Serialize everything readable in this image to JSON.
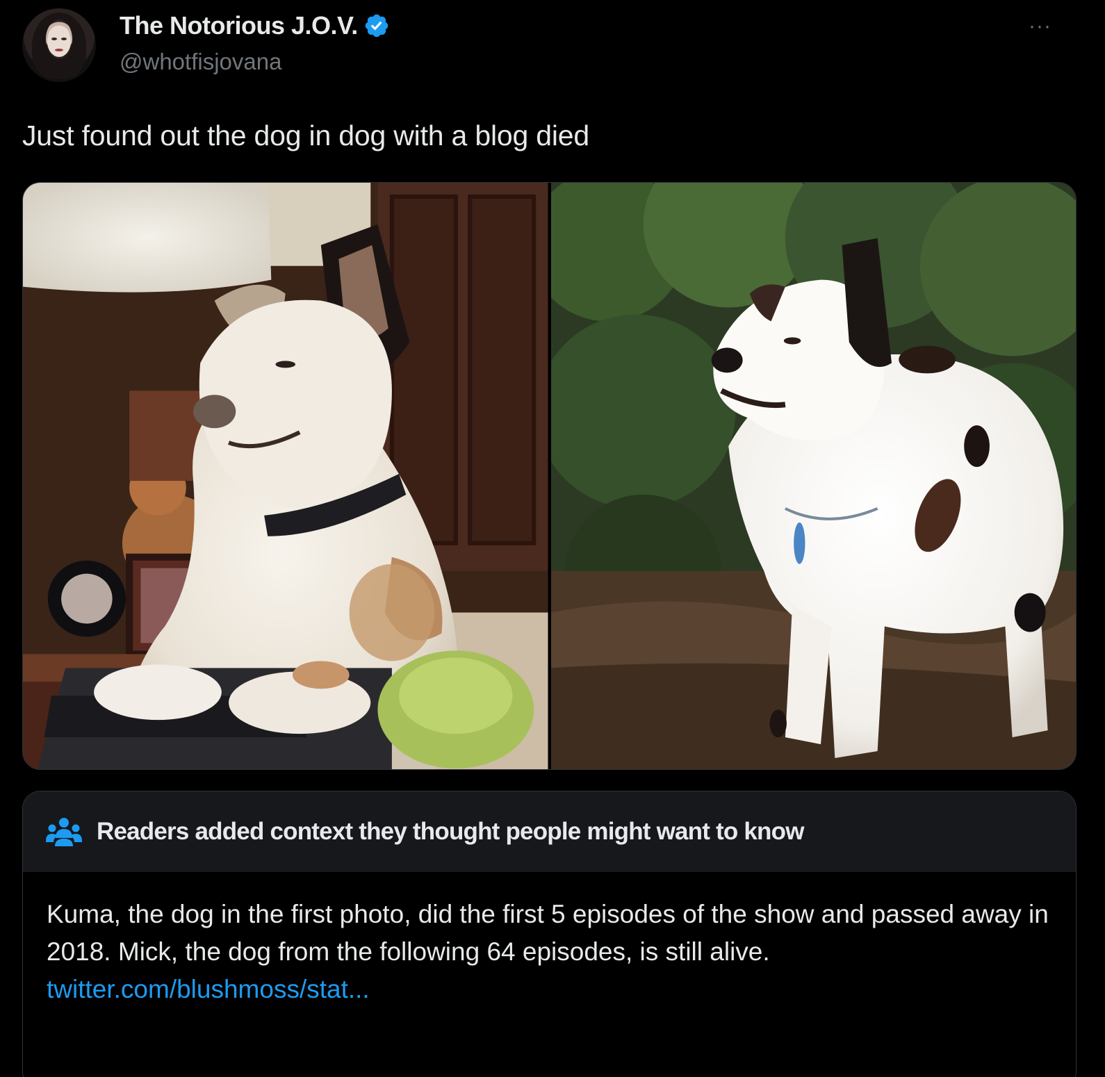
{
  "author": {
    "display_name": "The Notorious J.O.V.",
    "handle": "@whotfisjovana",
    "verified": true,
    "verified_color": "#1d9bf0",
    "avatar_icon": "profile-photo"
  },
  "menu": {
    "more_label": "···"
  },
  "tweet": {
    "text": "Just found out the dog in dog with a blog died",
    "media": [
      {
        "name": "photo-dog-at-keyboard"
      },
      {
        "name": "photo-spotted-dog-outdoors"
      }
    ]
  },
  "community_note": {
    "icon": "people-icon",
    "title": "Readers added context they thought people might want to know",
    "body": "Kuma, the dog in the first photo, did the first 5 episodes of the show and passed away in 2018. Mick, the dog from the following 64 episodes, is still alive.",
    "link": "twitter.com/blushmoss/stat..."
  },
  "colors": {
    "background": "#000000",
    "text": "#e7e9ea",
    "secondary_text": "#71767b",
    "accent": "#1d9bf0",
    "note_header_bg": "#16181c"
  }
}
